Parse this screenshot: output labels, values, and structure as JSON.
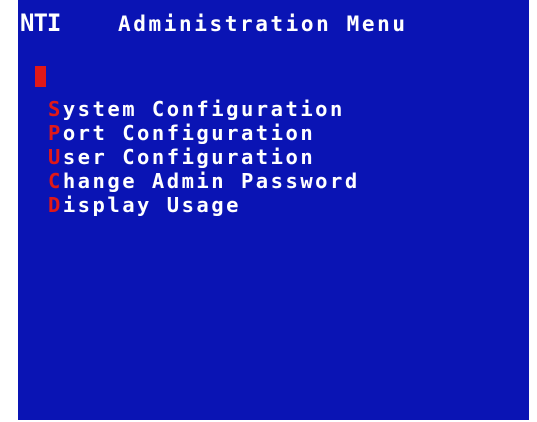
{
  "header": {
    "logo": "NTI",
    "title": "Administration Menu"
  },
  "colors": {
    "background": "#0a14b4",
    "text": "#ffffff",
    "highlight": "#e01818"
  },
  "menu": {
    "items": [
      {
        "hotkey": "S",
        "label": "ystem Configuration"
      },
      {
        "hotkey": "P",
        "label": "ort Configuration"
      },
      {
        "hotkey": "U",
        "label": "ser Configuration"
      },
      {
        "hotkey": "C",
        "label": "hange Admin Password"
      },
      {
        "hotkey": "D",
        "label": "isplay Usage"
      }
    ]
  }
}
